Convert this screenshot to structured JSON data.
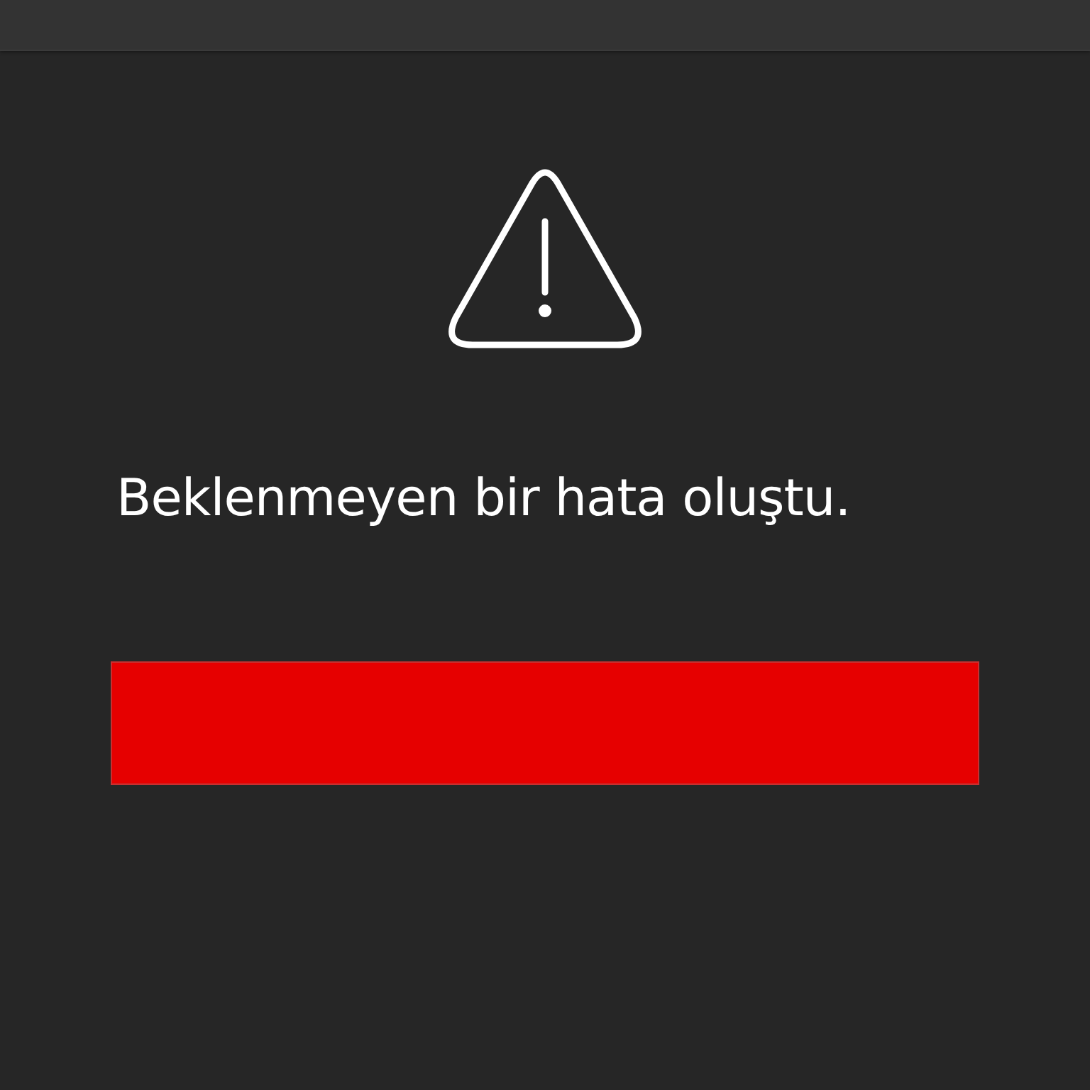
{
  "message": "Beklenmeyen bir hata oluştu."
}
